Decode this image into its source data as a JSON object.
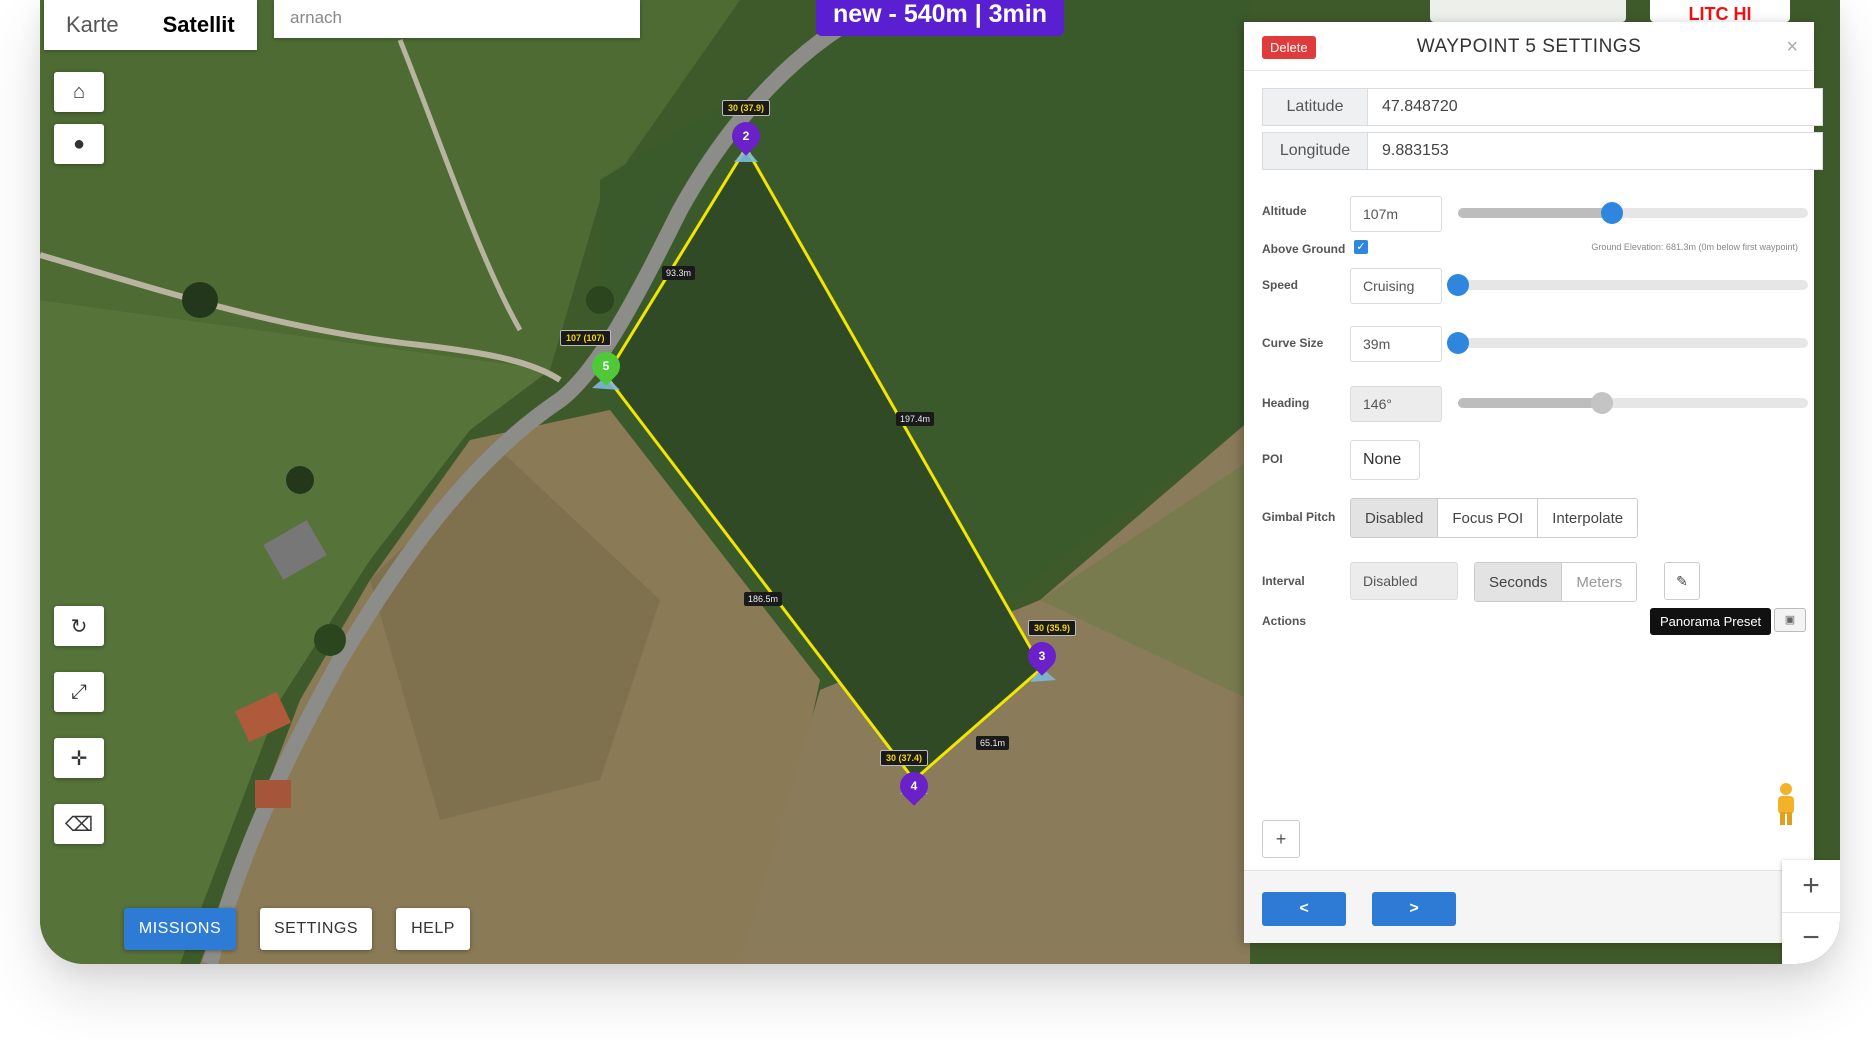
{
  "map": {
    "tabs": [
      {
        "label": "Karte"
      },
      {
        "label": "Satellit"
      }
    ],
    "search": {
      "value": "arnach"
    },
    "banner": "new - 540m | 3min",
    "logo_text": "LITC HI",
    "controls": [
      {
        "name": "home-icon",
        "glyph": "⌂"
      },
      {
        "name": "globe-icon",
        "glyph": "●"
      },
      {
        "name": "refresh-icon",
        "glyph": "↻"
      },
      {
        "name": "expand-icon",
        "glyph": "⤢"
      },
      {
        "name": "move-icon",
        "glyph": "✛"
      },
      {
        "name": "eraser-icon",
        "glyph": "⌫"
      }
    ],
    "bottom_buttons": [
      {
        "label": "MISSIONS"
      },
      {
        "label": "SETTINGS"
      },
      {
        "label": "HELP"
      }
    ],
    "waypoints": [
      {
        "id": "2",
        "label": "30 (37.9)",
        "color": "#6a21c9"
      },
      {
        "id": "5",
        "label": "107 (107)",
        "color": "#4fc93a"
      },
      {
        "id": "3",
        "label": "30 (35.9)",
        "color": "#6a21c9"
      },
      {
        "id": "4",
        "label": "30 (37.4)",
        "color": "#6a21c9"
      }
    ],
    "distances": [
      "93.3m",
      "197.4m",
      "186.5m",
      "65.1m"
    ],
    "route_color": "#f2e600"
  },
  "panel": {
    "title": "WAYPOINT 5 SETTINGS",
    "delete_label": "Delete",
    "close_glyph": "×",
    "latitude": {
      "label": "Latitude",
      "value": "47.848720"
    },
    "longitude": {
      "label": "Longitude",
      "value": "9.883153"
    },
    "altitude": {
      "label": "Altitude",
      "value": "107m",
      "slider_fraction": 0.44
    },
    "above_ground": {
      "label": "Above Ground",
      "checked": true
    },
    "ground_elevation": "Ground Elevation: 681.3m (0m below first waypoint)",
    "speed": {
      "label": "Speed",
      "value": "Cruising",
      "slider_fraction": 0.0
    },
    "curve_size": {
      "label": "Curve Size",
      "value": "39m",
      "slider_fraction": 0.0
    },
    "heading": {
      "label": "Heading",
      "value": "146°",
      "slider_fraction": 0.41
    },
    "poi": {
      "label": "POI",
      "value": "None"
    },
    "gimbal_pitch": {
      "label": "Gimbal Pitch",
      "options": [
        "Disabled",
        "Focus POI",
        "Interpolate"
      ],
      "selected": "Disabled"
    },
    "interval": {
      "label": "Interval",
      "value": "Disabled",
      "options": [
        "Seconds",
        "Meters"
      ],
      "selected": "Seconds"
    },
    "actions": {
      "label": "Actions",
      "tooltip": "Panorama Preset"
    },
    "add_label": "+",
    "prev_label": "<",
    "next_label": ">",
    "accent_color": "#2e7bd6",
    "knob_color": "#2e86de"
  },
  "zoom": {
    "in": "+",
    "out": "−"
  }
}
